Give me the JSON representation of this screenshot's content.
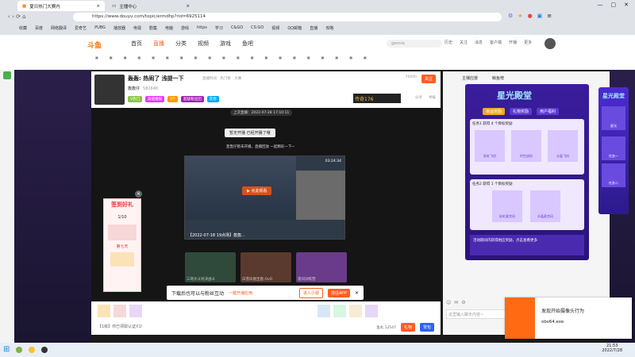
{
  "browser": {
    "tabs": [
      {
        "label": "夏日热门大赛内"
      },
      {
        "label": "主播中心"
      }
    ],
    "url": "https://www.douyu.com/topic/ermdhp?rid=6925114",
    "bookmarks": [
      "收藏",
      "百度",
      "网络翻译",
      "爱奇艺",
      "PUBG",
      "播放器",
      "电视",
      "剧集",
      "电脑",
      "游戏",
      "https",
      "学习",
      "C&GO",
      "CS:GO",
      "视频",
      "QQ邮箱",
      "直播",
      "攻略",
      "娱乐",
      "电影",
      "旅游",
      "音乐",
      "DBS2",
      "AAMI"
    ]
  },
  "site": {
    "logo": "斗鱼",
    "nav": [
      "首页",
      "直播",
      "分类",
      "视频",
      "游戏",
      "鱼吧"
    ],
    "search_placeholder": "gennie",
    "header_actions": [
      "历史",
      "关注",
      "消息",
      "客户端",
      "开播",
      "更多"
    ]
  },
  "room": {
    "title": "轰轰: 热闹了 浅提一下",
    "sub": "直播时间 · 热门榜 · 大赛",
    "streamer": "轰轰仔",
    "fans_count": "582648",
    "follow_label": "关注",
    "views": "70000",
    "tags": [
      "V热门",
      "高能播报",
      "5个",
      "超级粉丝团",
      "其他"
    ],
    "share": "分享",
    "report": "举报",
    "brand_banner": "传奇176"
  },
  "video": {
    "timestamp": "上次直播：2022-07-28 17:10:11",
    "cover_title": "暂无开播 已经开播了哦",
    "cover_sub": "轰轰仔暂未开播，直播回放 一起精彩一下~",
    "preview_title": "【2022-07-18 19点场】轰轰...",
    "preview_duration": "03:24:34",
    "preview_play": "▶ 点此观看",
    "thumbs": [
      {
        "title": "三哥大斗对决战斗"
      },
      {
        "title": "白雪凤凰宝盘 OvO"
      },
      {
        "title": "夜间训练营"
      }
    ]
  },
  "promo_left": {
    "title": "签到好礼",
    "sub": "1/10",
    "badge": "集合",
    "extra": "第七天"
  },
  "download_bar": {
    "text": "下载后也可以与粉丝互动",
    "link": "一键开播应用",
    "btn1": "进入小窗",
    "btn2": "前往APP"
  },
  "chat": {
    "placeholder": "这里输入聊天内容~",
    "send": "发送",
    "gift_bar": [
      "礼物",
      "背包",
      "鱼丸"
    ],
    "balance": "鱼丸 12547",
    "footer_text": "【1级】你已领取认证X1!"
  },
  "right_panel": {
    "top_tabs": [
      "主播应援",
      "鲸鱼榜"
    ],
    "promo_title": "星光殿堂",
    "promo_tabs": [
      "幸运奖励",
      "礼物奖励",
      "用户福利"
    ],
    "task1": "任务1 获得 4 个目标奖励",
    "task2": "任务2 获得 1 个目标奖励",
    "items": [
      "彩虹飞机",
      "时空战机",
      "水晶飞机",
      "彩虹麦克风",
      "水晶麦克风"
    ],
    "footer": "活动期间内获得相应奖励，点击查看更多",
    "side_tabs": [
      "星光",
      "任务一",
      "任务二"
    ],
    "side_title": "星光殿堂"
  },
  "notification": {
    "title": "发现开始摄像头行为",
    "user": "obs64.exe"
  },
  "taskbar": {
    "time": "21:53",
    "date": "2022/7/28"
  }
}
